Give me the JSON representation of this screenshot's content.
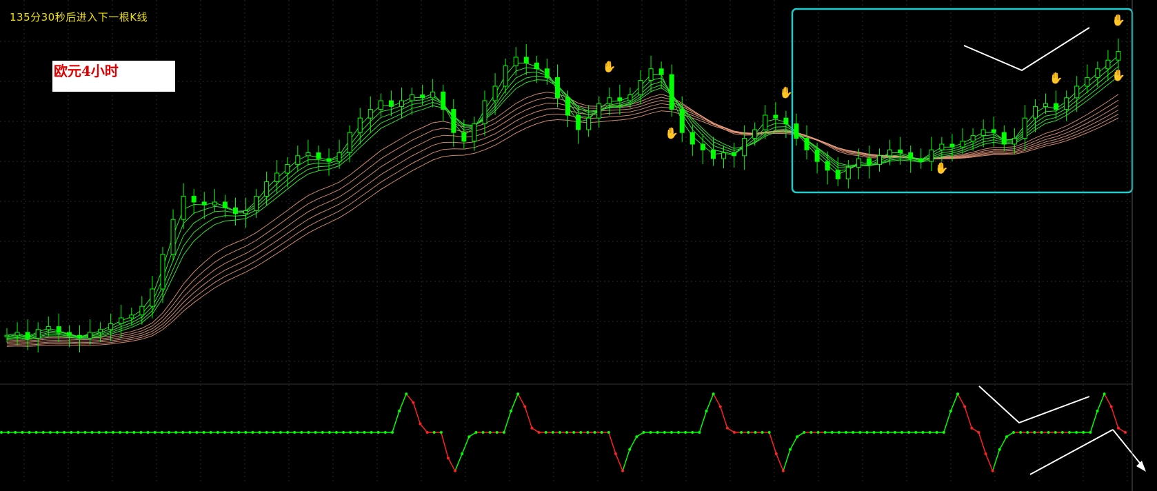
{
  "countdown_text": "135分30秒后进入下一根K线",
  "pair_label": "欧元4小时",
  "colors": {
    "background": "#000000",
    "candle": "#00ff00",
    "fast_ma": "#33dd33",
    "slow_ma": "#f0a080",
    "highlight_box": "#22cccc",
    "osc_up": "#00ff00",
    "osc_down": "#ff2020",
    "reversal_top_hand": "#e01010",
    "reversal_bottom_hand": "#2090ff",
    "annotation_line": "#ffffff"
  },
  "chart_data": [
    {
      "type": "line",
      "panel": "price",
      "description_series": "candlestick price with moving-average ribbons",
      "series": [
        {
          "values": [
            0.74,
            0.75,
            0.73,
            0.76,
            0.77,
            0.75,
            0.74,
            0.73,
            0.75,
            0.76,
            0.78,
            0.8,
            0.81,
            0.84,
            0.9,
            1.02,
            1.14,
            1.22,
            1.2,
            1.19,
            1.2,
            1.18,
            1.16,
            1.17,
            1.22,
            1.27,
            1.3,
            1.33,
            1.36,
            1.37,
            1.35,
            1.34,
            1.37,
            1.44,
            1.49,
            1.52,
            1.55,
            1.53,
            1.55,
            1.57,
            1.56,
            1.58,
            1.52,
            1.44,
            1.41,
            1.47,
            1.55,
            1.6,
            1.67,
            1.7,
            1.68,
            1.66,
            1.63,
            1.56,
            1.5,
            1.45,
            1.49,
            1.54,
            1.56,
            1.55,
            1.57,
            1.62,
            1.66,
            1.64,
            1.52,
            1.44,
            1.4,
            1.38,
            1.35,
            1.37,
            1.36,
            1.42,
            1.45,
            1.5,
            1.49,
            1.47,
            1.42,
            1.38,
            1.34,
            1.31,
            1.28,
            1.32,
            1.35,
            1.33,
            1.36,
            1.38,
            1.37,
            1.35,
            1.34,
            1.38,
            1.4,
            1.39,
            1.41,
            1.43,
            1.45,
            1.44,
            1.4,
            1.42,
            1.49,
            1.53,
            1.54,
            1.52,
            1.56,
            1.6,
            1.63,
            1.66,
            1.69,
            1.72
          ]
        }
      ],
      "markers": [
        {
          "kind": "top-hand",
          "x": 58
        },
        {
          "kind": "bottom-hand",
          "x": 64
        },
        {
          "kind": "top-hand",
          "x": 75
        },
        {
          "kind": "bottom-hand",
          "x": 90
        },
        {
          "kind": "top-hand",
          "x": 101
        },
        {
          "kind": "bottom-hand",
          "x": 113
        },
        {
          "kind": "top-hand",
          "x": 134
        },
        {
          "kind": "bottom-hand",
          "x": 140
        },
        {
          "kind": "top-hand",
          "x": 153
        }
      ]
    },
    {
      "type": "line",
      "panel": "oscillator",
      "description_series": "oscillator with green rising and red falling segments",
      "series": [
        {
          "values": [
            0,
            0,
            0,
            0,
            0,
            0,
            0,
            0,
            0,
            0,
            0,
            0,
            0,
            0,
            0,
            0,
            0,
            0,
            0,
            0,
            0,
            0,
            0,
            0,
            0,
            0,
            0,
            0,
            0,
            0,
            0,
            0,
            0,
            0,
            0,
            0,
            0,
            0,
            0,
            0,
            0,
            0,
            0,
            0,
            0,
            0,
            0,
            0,
            0,
            0,
            0,
            0,
            0,
            0,
            0,
            0,
            0,
            0.5,
            0.9,
            0.7,
            0.2,
            0,
            0,
            0,
            -0.6,
            -0.9,
            -0.5,
            -0.1,
            0,
            0,
            0,
            0,
            0,
            0.5,
            0.9,
            0.6,
            0.1,
            0,
            0,
            0,
            0,
            0,
            0,
            0,
            0,
            0,
            0,
            0,
            -0.5,
            -0.9,
            -0.4,
            -0.1,
            0,
            0,
            0,
            0,
            0,
            0,
            0,
            0,
            0,
            0.5,
            0.9,
            0.6,
            0.1,
            0,
            0,
            0,
            0,
            0,
            0,
            -0.5,
            -0.9,
            -0.4,
            -0.1,
            0,
            0,
            0,
            0,
            0,
            0,
            0,
            0,
            0,
            0,
            0,
            0,
            0,
            0,
            0,
            0,
            0,
            0,
            0,
            0,
            0,
            0.5,
            0.9,
            0.6,
            0.1,
            0,
            -0.5,
            -0.9,
            -0.4,
            -0.1,
            0,
            0,
            0,
            0,
            0,
            0,
            0,
            0,
            0,
            0,
            0,
            0,
            0.5,
            0.9,
            0.6,
            0.1,
            0
          ]
        }
      ]
    }
  ]
}
